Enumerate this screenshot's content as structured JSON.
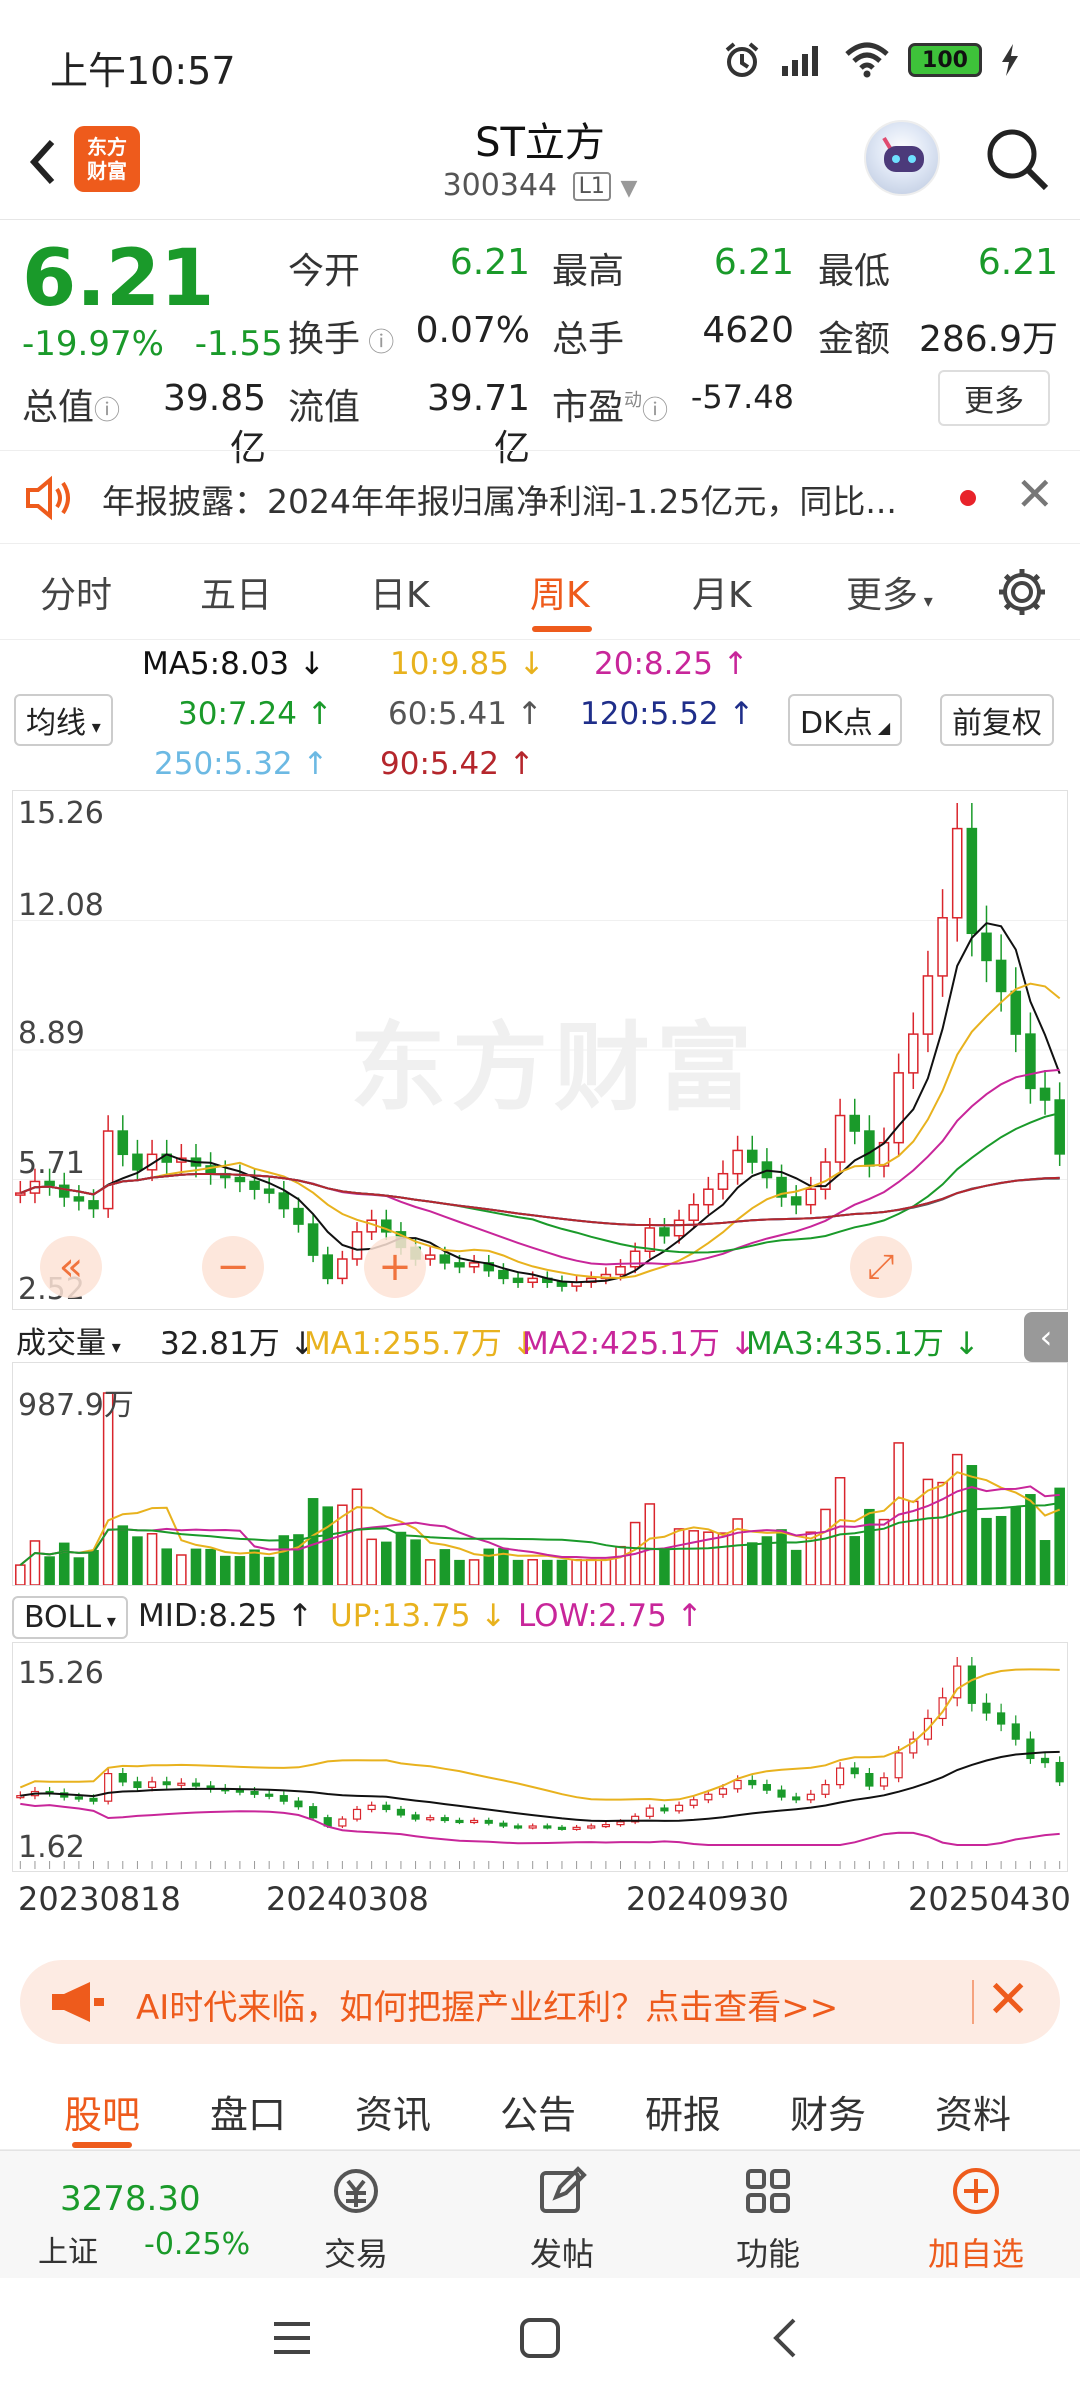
{
  "status": {
    "time": "上午10:57",
    "battery": "100"
  },
  "header": {
    "logo_line1": "东方",
    "logo_line2": "财富",
    "name": "ST立方",
    "code": "300344",
    "level": "L1"
  },
  "quote": {
    "price": "6.21",
    "pct": "-19.97%",
    "change": "-1.55",
    "open_label": "今开",
    "open": "6.21",
    "high_label": "最高",
    "high": "6.21",
    "low_label": "最低",
    "low": "6.21",
    "turnover_label": "换手",
    "turnover": "0.07%",
    "volume_label": "总手",
    "volume": "4620",
    "amount_label": "金额",
    "amount": "286.9万",
    "mcap_label": "总值",
    "mcap": "39.85亿",
    "float_label": "流值",
    "float": "39.71亿",
    "pe_label": "市盈",
    "pe_sup": "动",
    "pe": "-57.48",
    "more": "更多"
  },
  "notice": {
    "text": "年报披露：2024年年报归属净利润-1.25亿元，同比..."
  },
  "tabs": [
    "分时",
    "五日",
    "日K",
    "周K",
    "月K",
    "更多"
  ],
  "ma_legend": {
    "selector": "均线",
    "ma5": "MA5:8.03",
    "ma10": "10:9.85",
    "ma20": "20:8.25",
    "ma30": "30:7.24",
    "ma60": "60:5.41",
    "ma120": "120:5.52",
    "ma250": "250:5.32",
    "ma90": "90:5.42",
    "dk": "DK点",
    "adj": "前复权"
  },
  "price_axis": [
    "15.26",
    "12.08",
    "8.89",
    "5.71",
    "2.52"
  ],
  "watermark": "东方财富",
  "volume_legend": {
    "selector": "成交量",
    "current": "32.81万",
    "ma1": "MA1:255.7万",
    "ma2": "MA2:425.1万",
    "ma3": "MA3:435.1万",
    "max": "987.9万"
  },
  "boll_legend": {
    "selector": "BOLL",
    "mid": "MID:8.25",
    "up": "UP:13.75",
    "low": "LOW:2.75",
    "max": "15.26",
    "min": "1.62"
  },
  "dates": [
    "20230818",
    "20240308",
    "20240930",
    "20250430"
  ],
  "promo": {
    "text": "AI时代来临，如何把握产业红利？点击查看>>"
  },
  "bottom_tabs": [
    "股吧",
    "盘口",
    "资讯",
    "公告",
    "研报",
    "财务",
    "资料"
  ],
  "action_bar": {
    "index_value": "3278.30",
    "index_name": "上证",
    "index_change": "-0.25%",
    "trade": "交易",
    "post": "发帖",
    "func": "功能",
    "add": "加自选"
  },
  "colors": {
    "up": "#d9252c",
    "down": "#1a9a2a",
    "accent": "#ee5b1c",
    "ma5": "#111111",
    "ma10": "#e8b21e",
    "ma20": "#c8269a",
    "ma30": "#1a9a2a",
    "ma60": "#555555",
    "ma120": "#1f2e8a",
    "ma250": "#6cb9e3",
    "ma90": "#b5262c"
  },
  "chart_data": {
    "type": "candlestick",
    "period": "weekly",
    "ylim": [
      2.52,
      15.26
    ],
    "closes": [
      5.2,
      5.5,
      5.4,
      5.1,
      5.0,
      4.8,
      6.8,
      6.2,
      5.8,
      6.2,
      6.0,
      6.1,
      5.9,
      5.7,
      5.6,
      5.5,
      5.3,
      5.2,
      4.8,
      4.4,
      3.6,
      3.0,
      3.5,
      4.2,
      4.5,
      4.2,
      3.8,
      3.5,
      3.6,
      3.4,
      3.3,
      3.4,
      3.2,
      3.0,
      2.9,
      3.0,
      2.9,
      2.8,
      2.9,
      3.0,
      3.1,
      3.3,
      3.7,
      4.3,
      4.1,
      4.5,
      4.9,
      5.3,
      5.7,
      6.3,
      6.0,
      5.6,
      5.1,
      4.9,
      5.3,
      6.0,
      7.2,
      6.8,
      5.9,
      6.5,
      8.3,
      9.3,
      10.8,
      12.3,
      14.6,
      11.9,
      11.2,
      10.4,
      9.3,
      7.9,
      7.6,
      6.21
    ]
  }
}
